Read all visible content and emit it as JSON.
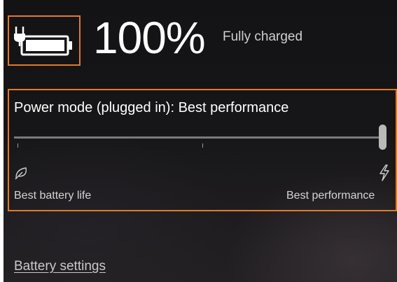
{
  "battery": {
    "icon": "battery-plugged-icon",
    "percent": "100%",
    "status": "Fully charged"
  },
  "power_mode": {
    "title": "Power mode (plugged in): Best performance",
    "slider_level": 1.0,
    "left_icon": "leaf-icon",
    "left_label": "Best battery life",
    "right_icon": "lightning-bolt-icon",
    "right_label": "Best performance"
  },
  "links": {
    "battery_settings": "Battery settings"
  },
  "colors": {
    "highlight_border": "#e07a2c",
    "background": "#161618",
    "text": "#ffffff"
  }
}
